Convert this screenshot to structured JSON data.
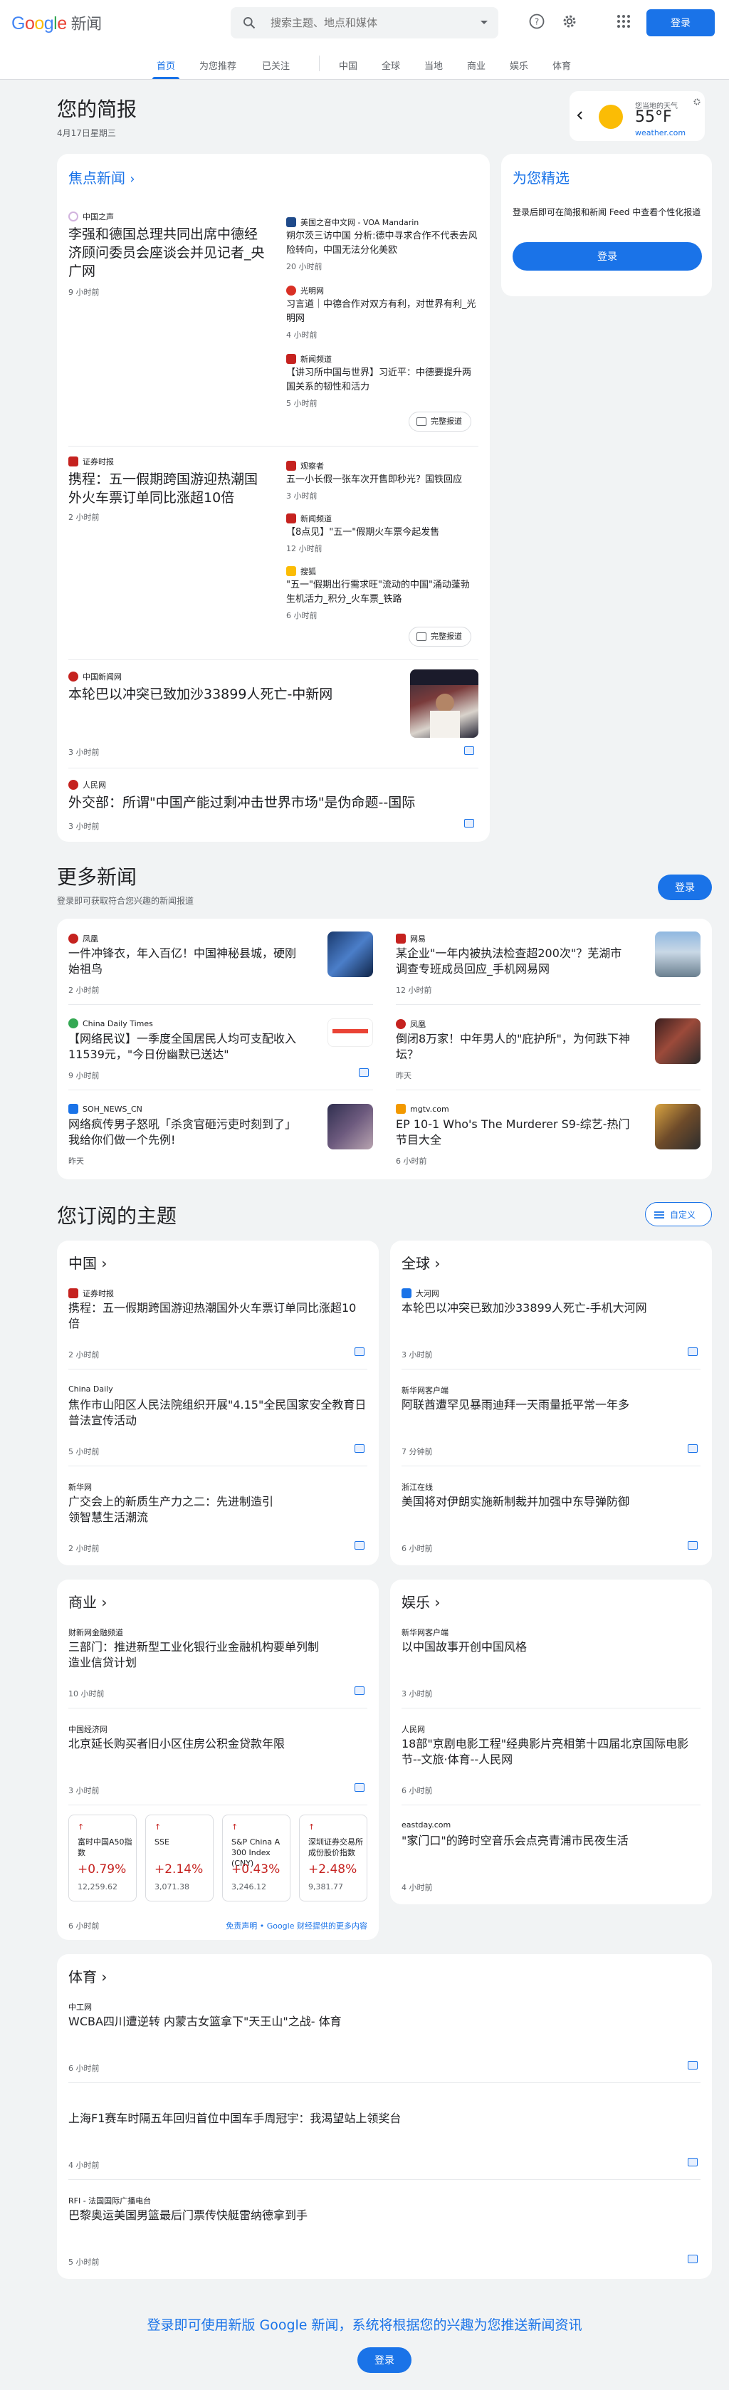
{
  "header": {
    "logo_word": "Google",
    "logo_suffix": "新闻",
    "search_placeholder": "搜索主题、地点和媒体",
    "signin": "登录"
  },
  "nav": {
    "tabs": [
      "首页",
      "为您推荐",
      "已关注",
      "中国",
      "全球",
      "当地",
      "商业",
      "娱乐",
      "体育"
    ]
  },
  "briefing": {
    "title": "您的简报",
    "date": "4月17日星期三"
  },
  "weather": {
    "label": "您当地的天气",
    "temp": "55°F",
    "source": "weather.com"
  },
  "picks": {
    "title": "为您精选",
    "text": "登录后即可在简报和新闻 Feed 中查看个性化报道",
    "button": "登录"
  },
  "top": {
    "title": "焦点新闻",
    "full_coverage": "完整报道",
    "clusters": [
      {
        "main": {
          "source": "中国之声",
          "title": "李强和德国总理共同出席中德经济顾问委员会座谈会并见记者_央广网",
          "time": "9 小时前"
        },
        "side": [
          {
            "source": "美国之音中文网 - VOA Mandarin",
            "title": "朔尔茨三访中国 分析:德中寻求合作不代表去风险转向，中国无法分化美欧",
            "time": "20 小时前"
          },
          {
            "source": "光明网",
            "title": "习言道｜中德合作对双方有利，对世界有利_光明网",
            "time": "4 小时前"
          },
          {
            "source": "新闻频道",
            "title": "【讲习所中国与世界】习近平：中德要提升两国关系的韧性和活力",
            "time": "5 小时前"
          }
        ]
      },
      {
        "main": {
          "source": "证券时报",
          "title": "携程：五一假期跨国游迎热潮国外火车票订单同比涨超10倍",
          "time": "2 小时前"
        },
        "side": [
          {
            "source": "观察者",
            "title": "五一小长假一张车次开售即秒光？国铁回应",
            "time": "3 小时前"
          },
          {
            "source": "新闻频道",
            "title": "【8点见】\"五一\"假期火车票今起发售",
            "time": "12 小时前"
          },
          {
            "source": "搜狐",
            "title": "\"五一\"假期出行需求旺\"流动的中国\"涌动蓬勃生机活力_积分_火车票_铁路",
            "time": "6 小时前"
          }
        ]
      }
    ],
    "singles": [
      {
        "source": "中国新闻网",
        "title": "本轮巴以冲突已致加沙33899人死亡-中新网",
        "time": "3 小时前"
      },
      {
        "source": "人民网",
        "title": "外交部：所谓\"中国产能过剩冲击世界市场\"是伪命题--国际",
        "time": "3 小时前"
      }
    ]
  },
  "more": {
    "title": "更多新闻",
    "sub": "登录即可获取符合您兴趣的新闻报道",
    "button": "登录",
    "items": [
      {
        "source": "凤凰",
        "title": "一件冲锋衣，年入百亿！中国神秘县城，硬刚始祖鸟",
        "time": "2 小时前"
      },
      {
        "source": "网易",
        "title": "某企业\"一年内被执法检查超200次\"？芜湖市调查专班成员回应_手机网易网",
        "time": "12 小时前"
      },
      {
        "source": "China Daily Times",
        "title": "【网络民议】一季度全国居民人均可支配收入11539元，\"今日份幽默已送达\"",
        "time": "9 小时前"
      },
      {
        "source": "凤凰",
        "title": "倒闭8万家！中年男人的\"庇护所\"，为何跌下神坛？",
        "time": "昨天"
      },
      {
        "source": "SOH_NEWS_CN",
        "title": "网络疯传男子怒吼「杀贪官砸污吏时刻到了」我给你们做一个先例!",
        "time": "昨天"
      },
      {
        "source": "mgtv.com",
        "title": "EP 10-1 Who's The Murderer S9-综艺-热门节目大全",
        "time": "6 小时前"
      }
    ]
  },
  "topics": {
    "title": "您订阅的主题",
    "customize": "自定义",
    "china": {
      "title": "中国",
      "items": [
        {
          "source": "证券时报",
          "title": "携程：五一假期跨国游迎热潮国外火车票订单同比涨超10倍",
          "time": "2 小时前"
        },
        {
          "source": "China Daily",
          "title": "焦作市山阳区人民法院组织开展\"4.15\"全民国家安全教育日普法宣传活动",
          "time": "5 小时前"
        },
        {
          "source": "新华网",
          "title": "广交会上的新质生产力之二：先进制造引领智慧生活潮流",
          "time": "2 小时前"
        }
      ]
    },
    "world": {
      "title": "全球",
      "items": [
        {
          "source": "大河网",
          "title": "本轮巴以冲突已致加沙33899人死亡-手机大河网",
          "time": "3 小时前"
        },
        {
          "source": "新华网客户端",
          "title": "阿联酋遭罕见暴雨迪拜一天雨量抵平常一年多",
          "time": "7 分钟前"
        },
        {
          "source": "浙江在线",
          "title": "美国将对伊朗实施新制裁并加强中东导弹防御",
          "time": "6 小时前"
        }
      ]
    },
    "business": {
      "title": "商业",
      "items": [
        {
          "source": "财新网金融频道",
          "title": "三部门：推进新型工业化银行业金融机构要单列制造业信贷计划",
          "time": "10 小时前"
        },
        {
          "source": "中国经济网",
          "title": "北京延长购买者旧小区住房公积金贷款年限",
          "time": "3 小时前"
        }
      ],
      "stocks": [
        {
          "name": "富时中国A50指数",
          "change": "+0.79%",
          "price": "12,259.62"
        },
        {
          "name": "SSE",
          "change": "+2.14%",
          "price": "3,071.38"
        },
        {
          "name": "S&P China A 300 Index (CNY)",
          "change": "+0.43%",
          "price": "3,246.12"
        },
        {
          "name": "深圳证券交易所成份股价指数",
          "change": "+2.48%",
          "price": "9,381.77"
        }
      ],
      "time": "6 小时前",
      "disclaimer": "免责声明 • Google 财经提供的更多内容"
    },
    "ent": {
      "title": "娱乐",
      "items": [
        {
          "source": "新华网客户端",
          "title": "以中国故事开创中国风格",
          "time": "3 小时前"
        },
        {
          "source": "人民网",
          "title": "18部\"京剧电影工程\"经典影片亮相第十四届北京国际电影节--文旅·体育--人民网",
          "time": "6 小时前"
        },
        {
          "source": "eastday.com",
          "title": "\"家门口\"的跨时空音乐会点亮青浦市民夜生活",
          "time": "4 小时前"
        }
      ]
    },
    "sports": {
      "title": "体育",
      "items": [
        {
          "source": "中工网",
          "title": "WCBA四川遭逆转 内蒙古女篮拿下\"天王山\"之战- 体育",
          "time": "6 小时前"
        },
        {
          "source": "",
          "title": "上海F1赛车时隔五年回归首位中国车手周冠宇：我渴望站上领奖台",
          "time": "4 小时前"
        },
        {
          "source": "RFI - 法国国际广播电台",
          "title": "巴黎奥运美国男篮最后门票传快艇雷纳德拿到手",
          "time": "5 小时前"
        }
      ]
    }
  },
  "footer": {
    "text": "登录即可使用新版 Google 新闻，系统将根据您的兴趣为您推送新闻资讯",
    "button": "登录"
  },
  "colors": {
    "accent": "#1a73e8",
    "red": "#c5221f",
    "bg": "#f1f3f4"
  }
}
